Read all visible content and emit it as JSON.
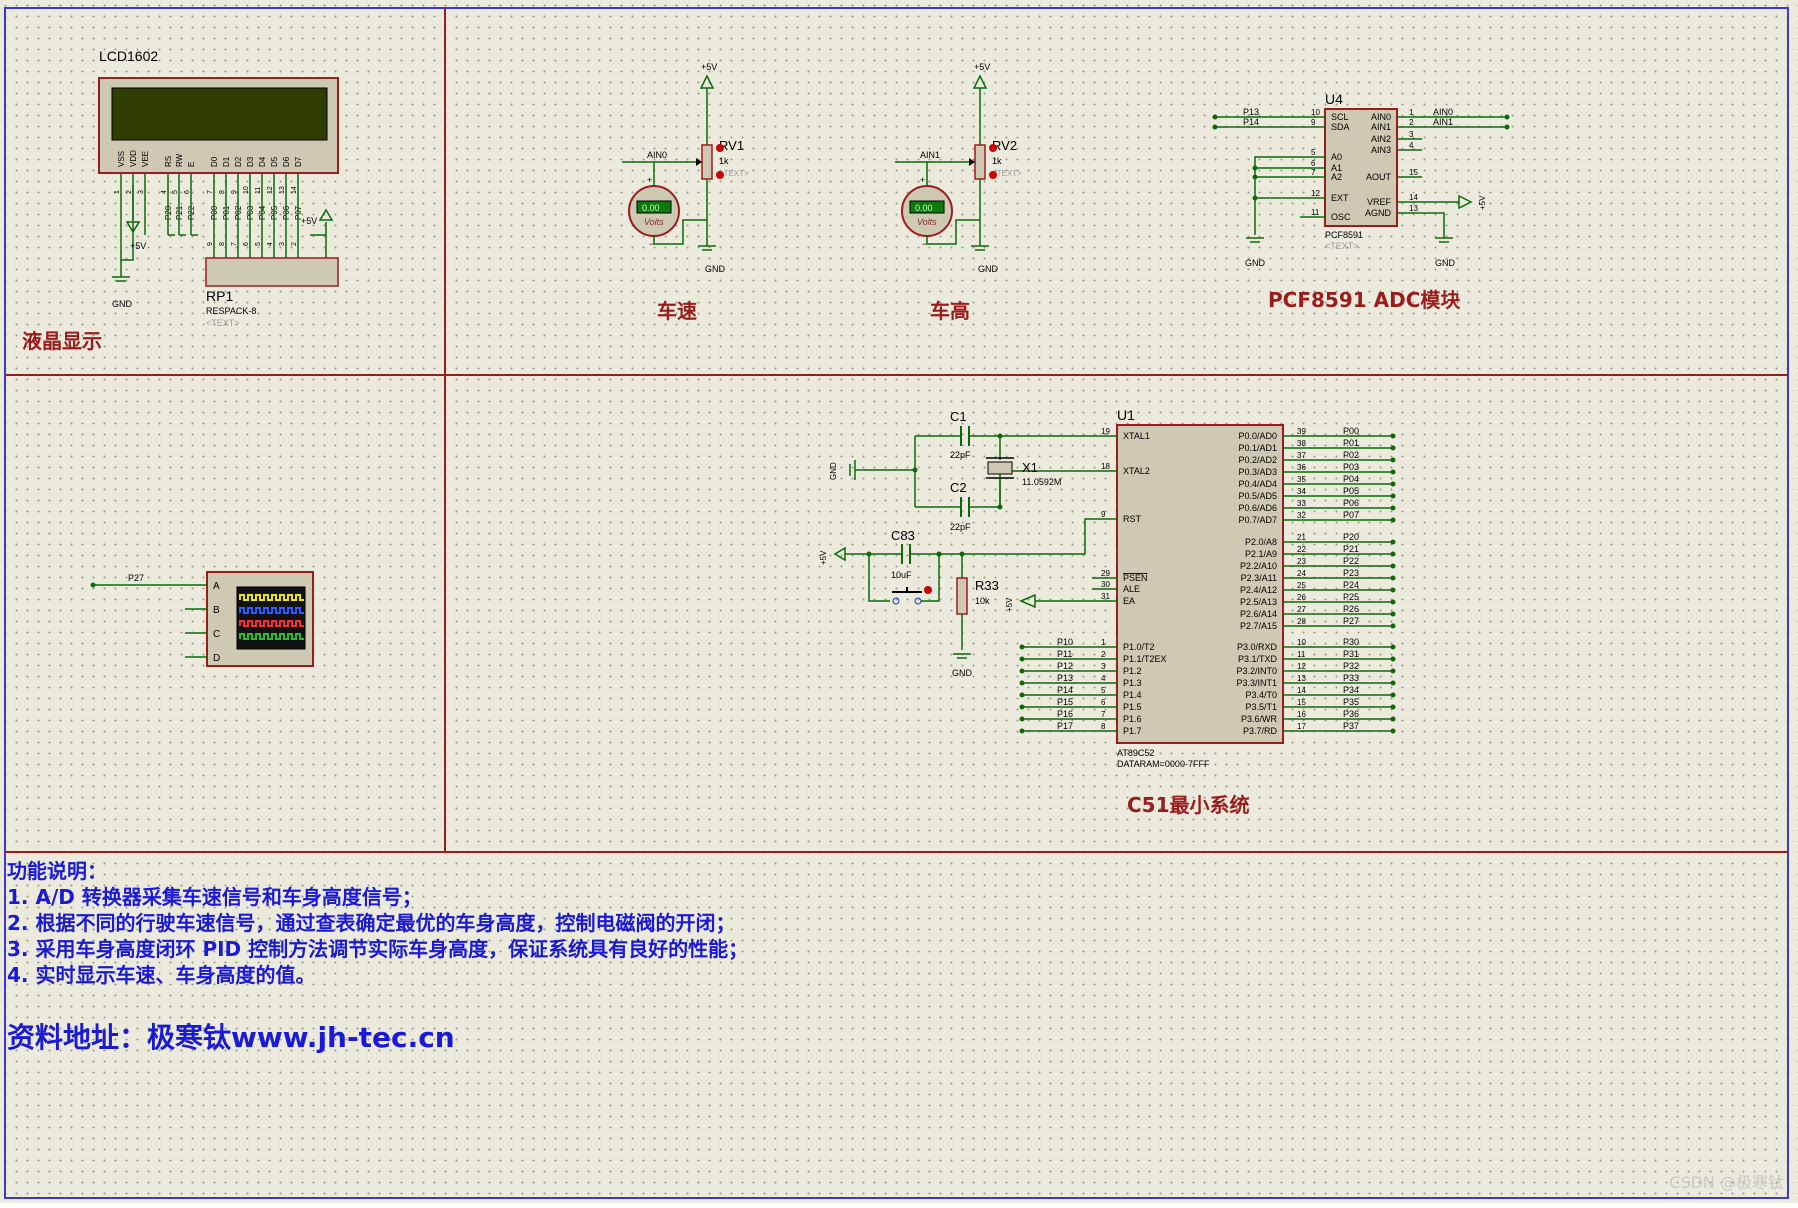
{
  "sections": {
    "lcd": "液晶显示",
    "speed": "车速",
    "height": "车高",
    "adc": "PCF8591 ADC模块",
    "mcu": "C51最小系统"
  },
  "lcd": {
    "ref": "LCD1602",
    "pins": [
      "VSS",
      "VDD",
      "VEE",
      "RS",
      "RW",
      "E",
      "D0",
      "D1",
      "D2",
      "D3",
      "D4",
      "D5",
      "D6",
      "D7"
    ],
    "pin_numbers": [
      "1",
      "2",
      "3",
      "4",
      "5",
      "6",
      "7",
      "8",
      "9",
      "10",
      "11",
      "12",
      "13",
      "14"
    ],
    "ctrl_nets": [
      "P20",
      "P21",
      "P22"
    ],
    "data_nets": [
      "P00",
      "P01",
      "P02",
      "P03",
      "P04",
      "P05",
      "P06",
      "P07"
    ],
    "vcc": "+5V",
    "gnd": "GND"
  },
  "rp1": {
    "ref": "RP1",
    "value": "RESPACK-8",
    "text": "<TEXT>",
    "pin_numbers": [
      "9",
      "8",
      "7",
      "6",
      "5",
      "4",
      "3",
      "2",
      "1"
    ],
    "vcc": "+5V"
  },
  "rv1": {
    "ref": "RV1",
    "value": "1k",
    "text": "<TEXT>",
    "net": "AIN0",
    "vcc": "+5V",
    "gnd": "GND",
    "meter": "Volts",
    "reading": "0.00"
  },
  "rv2": {
    "ref": "RV2",
    "value": "1k",
    "text": "<TEXT>",
    "net": "AIN1",
    "vcc": "+5V",
    "gnd": "GND",
    "meter": "Volts",
    "reading": "0.00"
  },
  "u4": {
    "ref": "U4",
    "part": "PCF8591",
    "text": "<TEXT>",
    "left_pins": [
      {
        "num": "10",
        "name": "SCL",
        "net": "P13"
      },
      {
        "num": "9",
        "name": "SDA",
        "net": "P14"
      },
      {
        "num": "5",
        "name": "A0",
        "net": ""
      },
      {
        "num": "6",
        "name": "A1",
        "net": ""
      },
      {
        "num": "7",
        "name": "A2",
        "net": ""
      },
      {
        "num": "12",
        "name": "EXT",
        "net": ""
      },
      {
        "num": "11",
        "name": "OSC",
        "net": ""
      }
    ],
    "right_pins": [
      {
        "num": "1",
        "name": "AIN0",
        "net": "AIN0"
      },
      {
        "num": "2",
        "name": "AIN1",
        "net": "AIN1"
      },
      {
        "num": "3",
        "name": "AIN2",
        "net": ""
      },
      {
        "num": "4",
        "name": "AIN3",
        "net": ""
      },
      {
        "num": "15",
        "name": "AOUT",
        "net": ""
      },
      {
        "num": "14",
        "name": "VREF",
        "net": ""
      },
      {
        "num": "13",
        "name": "AGND",
        "net": ""
      }
    ],
    "vref": "+5V",
    "gnd": "GND"
  },
  "scope": {
    "net": "P27",
    "channels": [
      "A",
      "B",
      "C",
      "D"
    ],
    "colors": [
      "#e8e800",
      "#2c5cff",
      "#ff2a2a",
      "#18c818"
    ]
  },
  "crystal": {
    "c1": {
      "ref": "C1",
      "value": "22pF"
    },
    "c2": {
      "ref": "C2",
      "value": "22pF"
    },
    "x1": {
      "ref": "X1",
      "value": "11.0592M"
    },
    "gnd": "GND"
  },
  "reset": {
    "c83": {
      "ref": "C83",
      "value": "10uF"
    },
    "r33": {
      "ref": "R33",
      "value": "10k"
    },
    "vcc": "+5V",
    "gnd": "GND",
    "ea_vcc": "+5V"
  },
  "u1": {
    "ref": "U1",
    "part": "AT89C52",
    "dataram": "DATARAM=0000-7FFF",
    "left_top": [
      {
        "num": "19",
        "name": "XTAL1"
      },
      {
        "num": "18",
        "name": "XTAL2"
      },
      {
        "num": "9",
        "name": "RST"
      },
      {
        "num": "29",
        "name": "PSEN"
      },
      {
        "num": "30",
        "name": "ALE"
      },
      {
        "num": "31",
        "name": "EA"
      }
    ],
    "p1": [
      {
        "num": "1",
        "name": "P1.0/T2",
        "net": "P10"
      },
      {
        "num": "2",
        "name": "P1.1/T2EX",
        "net": "P11"
      },
      {
        "num": "3",
        "name": "P1.2",
        "net": "P12"
      },
      {
        "num": "4",
        "name": "P1.3",
        "net": "P13"
      },
      {
        "num": "5",
        "name": "P1.4",
        "net": "P14"
      },
      {
        "num": "6",
        "name": "P1.5",
        "net": "P15"
      },
      {
        "num": "7",
        "name": "P1.6",
        "net": "P16"
      },
      {
        "num": "8",
        "name": "P1.7",
        "net": "P17"
      }
    ],
    "p0": [
      {
        "num": "39",
        "name": "P0.0/AD0",
        "net": "P00"
      },
      {
        "num": "38",
        "name": "P0.1/AD1",
        "net": "P01"
      },
      {
        "num": "37",
        "name": "P0.2/AD2",
        "net": "P02"
      },
      {
        "num": "36",
        "name": "P0.3/AD3",
        "net": "P03"
      },
      {
        "num": "35",
        "name": "P0.4/AD4",
        "net": "P04"
      },
      {
        "num": "34",
        "name": "P0.5/AD5",
        "net": "P05"
      },
      {
        "num": "33",
        "name": "P0.6/AD6",
        "net": "P06"
      },
      {
        "num": "32",
        "name": "P0.7/AD7",
        "net": "P07"
      }
    ],
    "p2": [
      {
        "num": "21",
        "name": "P2.0/A8",
        "net": "P20"
      },
      {
        "num": "22",
        "name": "P2.1/A9",
        "net": "P21"
      },
      {
        "num": "23",
        "name": "P2.2/A10",
        "net": "P22"
      },
      {
        "num": "24",
        "name": "P2.3/A11",
        "net": "P23"
      },
      {
        "num": "25",
        "name": "P2.4/A12",
        "net": "P24"
      },
      {
        "num": "26",
        "name": "P2.5/A13",
        "net": "P25"
      },
      {
        "num": "27",
        "name": "P2.6/A14",
        "net": "P26"
      },
      {
        "num": "28",
        "name": "P2.7/A15",
        "net": "P27"
      }
    ],
    "p3": [
      {
        "num": "10",
        "name": "P3.0/RXD",
        "net": "P30"
      },
      {
        "num": "11",
        "name": "P3.1/TXD",
        "net": "P31"
      },
      {
        "num": "12",
        "name": "P3.2/INT0",
        "net": "P32"
      },
      {
        "num": "13",
        "name": "P3.3/INT1",
        "net": "P33"
      },
      {
        "num": "14",
        "name": "P3.4/T0",
        "net": "P34"
      },
      {
        "num": "15",
        "name": "P3.5/T1",
        "net": "P35"
      },
      {
        "num": "16",
        "name": "P3.6/WR",
        "net": "P36"
      },
      {
        "num": "17",
        "name": "P3.7/RD",
        "net": "P37"
      }
    ]
  },
  "description": {
    "title": "功能说明：",
    "lines": [
      "1. A/D 转换器采集车速信号和车身高度信号；",
      "2. 根据不同的行驶车速信号，通过查表确定最优的车身高度，控制电磁阀的开闭；",
      "3. 采用车身高度闭环 PID 控制方法调节实际车身高度，保证系统具有良好的性能；",
      "4. 实时显示车速、车身高度的值。"
    ],
    "source": "资料地址：极寒钛www.jh-tec.cn"
  },
  "watermark": "CSDN @极寒钛",
  "colors": {
    "wire": "#0b6b0b",
    "part_border": "#9b1c1c",
    "part_fill": "#cdc9b3",
    "label": "#9b1c1c",
    "text_blue": "#1a1ad6",
    "frame": "#9b1c1c",
    "frame_blue": "#3a3ad0"
  }
}
